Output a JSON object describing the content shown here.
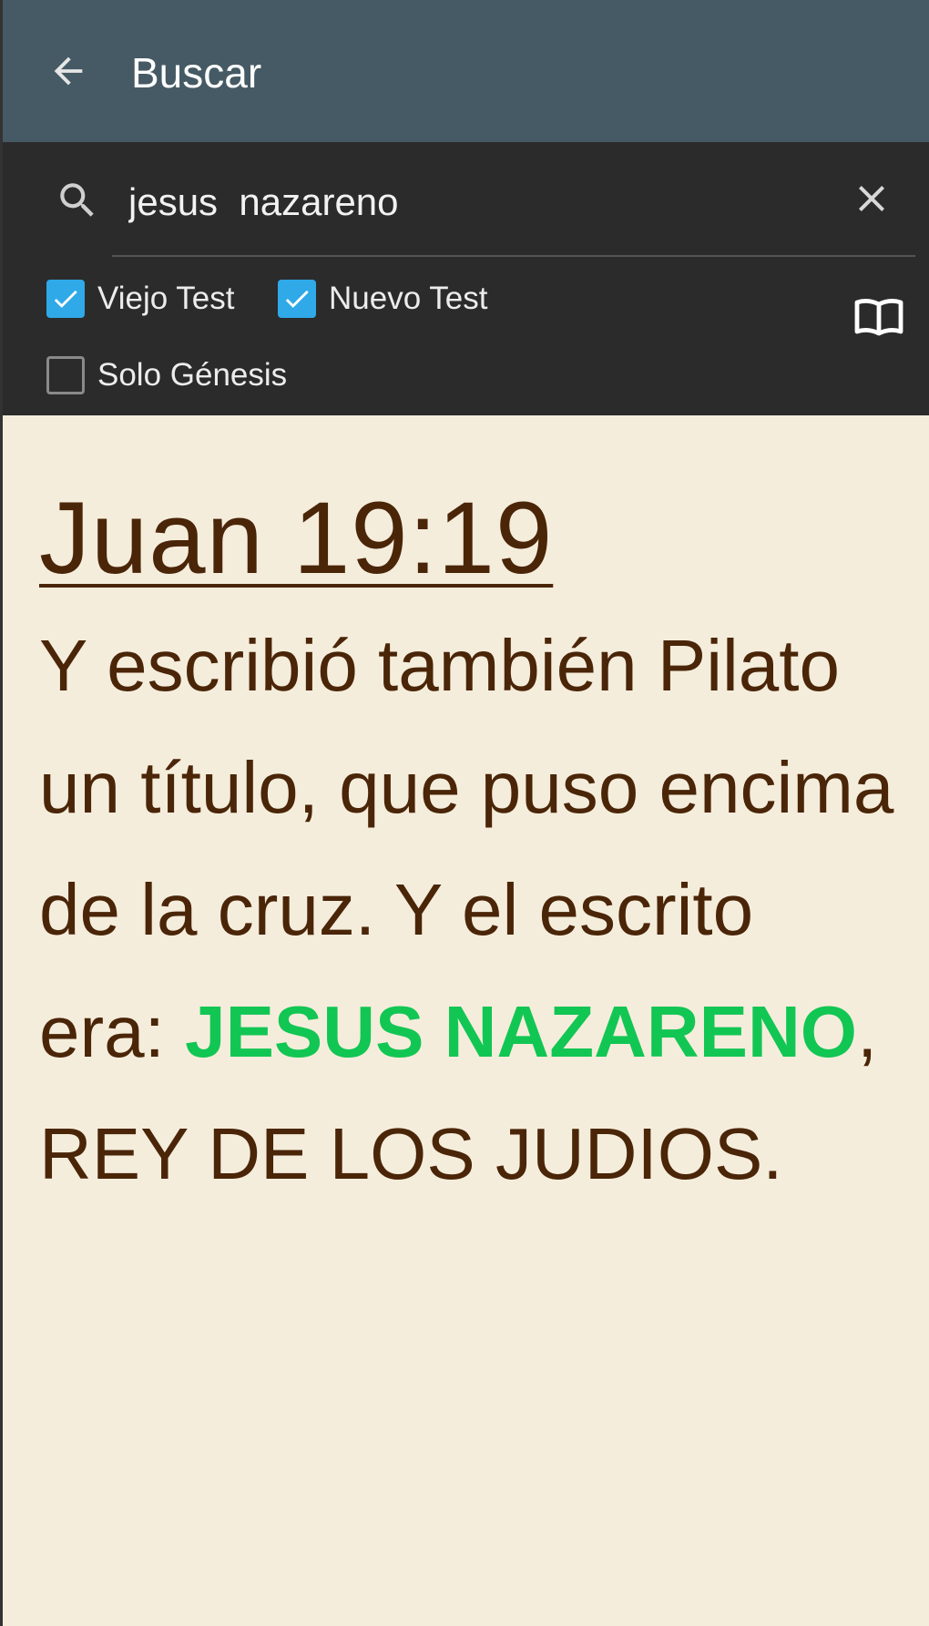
{
  "app_bar": {
    "title": "Buscar"
  },
  "search": {
    "query": "jesus  nazareno",
    "filters": [
      {
        "label": "Viejo Test",
        "checked": true
      },
      {
        "label": "Nuevo Test",
        "checked": true
      },
      {
        "label": "Solo Génesis",
        "checked": false
      }
    ]
  },
  "result": {
    "reference": "Juan 19:19",
    "text_before": "Y escribió también Pilato un título, que puso encima de la cruz. Y el escrito era: ",
    "highlight": "JESUS NAZARENO",
    "text_after": ", REY DE LOS JUDIOS."
  },
  "colors": {
    "app_bar": "#455a64",
    "search_panel": "#2b2b2b",
    "checkbox_checked": "#2fa9e8",
    "content_background": "#f5eddc",
    "verse_text": "#4a2508",
    "highlight": "#12c653"
  },
  "icons": {
    "back": "arrow-left-icon",
    "search": "search-icon",
    "clear": "close-icon",
    "book": "open-book-icon"
  }
}
